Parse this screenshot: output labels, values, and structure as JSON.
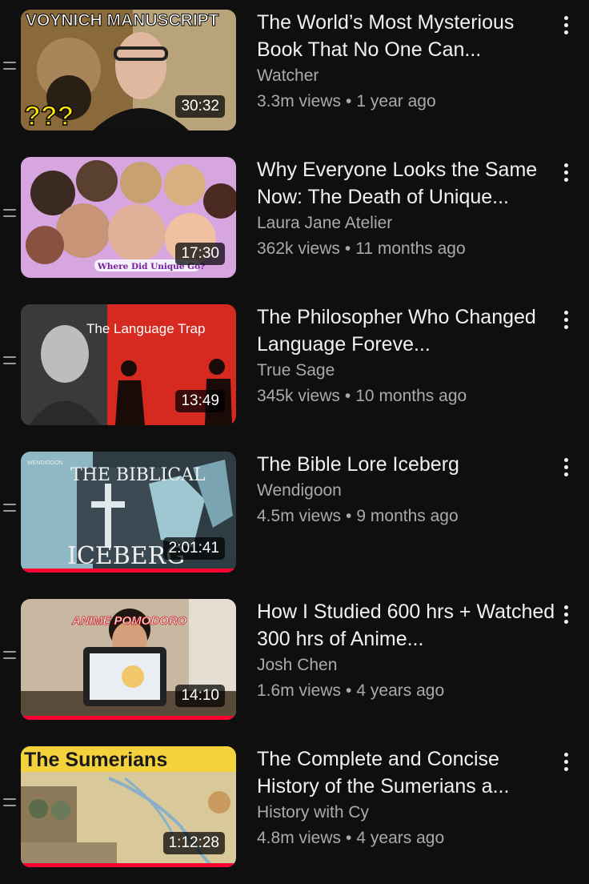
{
  "colors": {
    "background": "#0f0f0f",
    "text": "#f1f1f1",
    "secondary": "#aaaaaa",
    "progress": "#ff0033"
  },
  "videos": [
    {
      "title": "The World’s Most Mysterious Book That No One Can...",
      "channel": "Watcher",
      "views": "3.3m views",
      "age": "1 year ago",
      "duration": "30:32",
      "thumb_text": "VOYNICH MANUSCRIPT",
      "thumb_text2": "???",
      "watched_fraction": 0
    },
    {
      "title": "Why Everyone Looks the Same Now: The Death of Unique...",
      "channel": "Laura Jane Atelier",
      "views": "362k views",
      "age": "11 months ago",
      "duration": "17:30",
      "thumb_text": "Where Did Unique Go?",
      "watched_fraction": 0
    },
    {
      "title": "The Philosopher Who Changed Language Foreve...",
      "channel": "True Sage",
      "views": "345k views",
      "age": "10 months ago",
      "duration": "13:49",
      "thumb_text": "The Language Trap",
      "watched_fraction": 0
    },
    {
      "title": "The Bible Lore Iceberg",
      "channel": "Wendigoon",
      "views": "4.5m views",
      "age": "9 months ago",
      "duration": "2:01:41",
      "thumb_text": "THE BIBLICAL",
      "thumb_text2": "ICEBERG",
      "thumb_text3": "WENDIGOON",
      "watched_fraction": 1.0
    },
    {
      "title": "How I Studied 600 hrs + Watched 300 hrs of Anime...",
      "channel": "Josh Chen",
      "views": "1.6m views",
      "age": "4 years ago",
      "duration": "14:10",
      "thumb_text": "ANIME POMODORO",
      "watched_fraction": 1.0
    },
    {
      "title": "The Complete and Concise History of the Sumerians a...",
      "channel": "History with Cy",
      "views": "4.8m views",
      "age": "4 years ago",
      "duration": "1:12:28",
      "thumb_text": "The Sumerians",
      "watched_fraction": 1.0
    }
  ]
}
